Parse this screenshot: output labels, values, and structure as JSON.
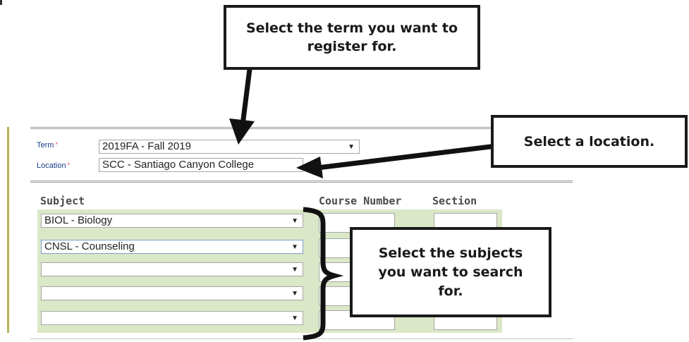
{
  "form": {
    "term_label": "Term",
    "location_label": "Location",
    "required_mark": "*",
    "term_value": "2019FA - Fall 2019",
    "location_value": "SCC - Santiago Canyon College"
  },
  "table": {
    "headers": {
      "subject": "Subject",
      "course_number": "Course Number",
      "section": "Section"
    },
    "subjects": [
      "BIOL - Biology",
      "CNSL - Counseling",
      "",
      "",
      ""
    ]
  },
  "dropdown_arrow": "▼",
  "callouts": {
    "term": "Select the term you want to register for.",
    "location": "Select a location.",
    "subjects": "Select the subjects you want to search for."
  }
}
